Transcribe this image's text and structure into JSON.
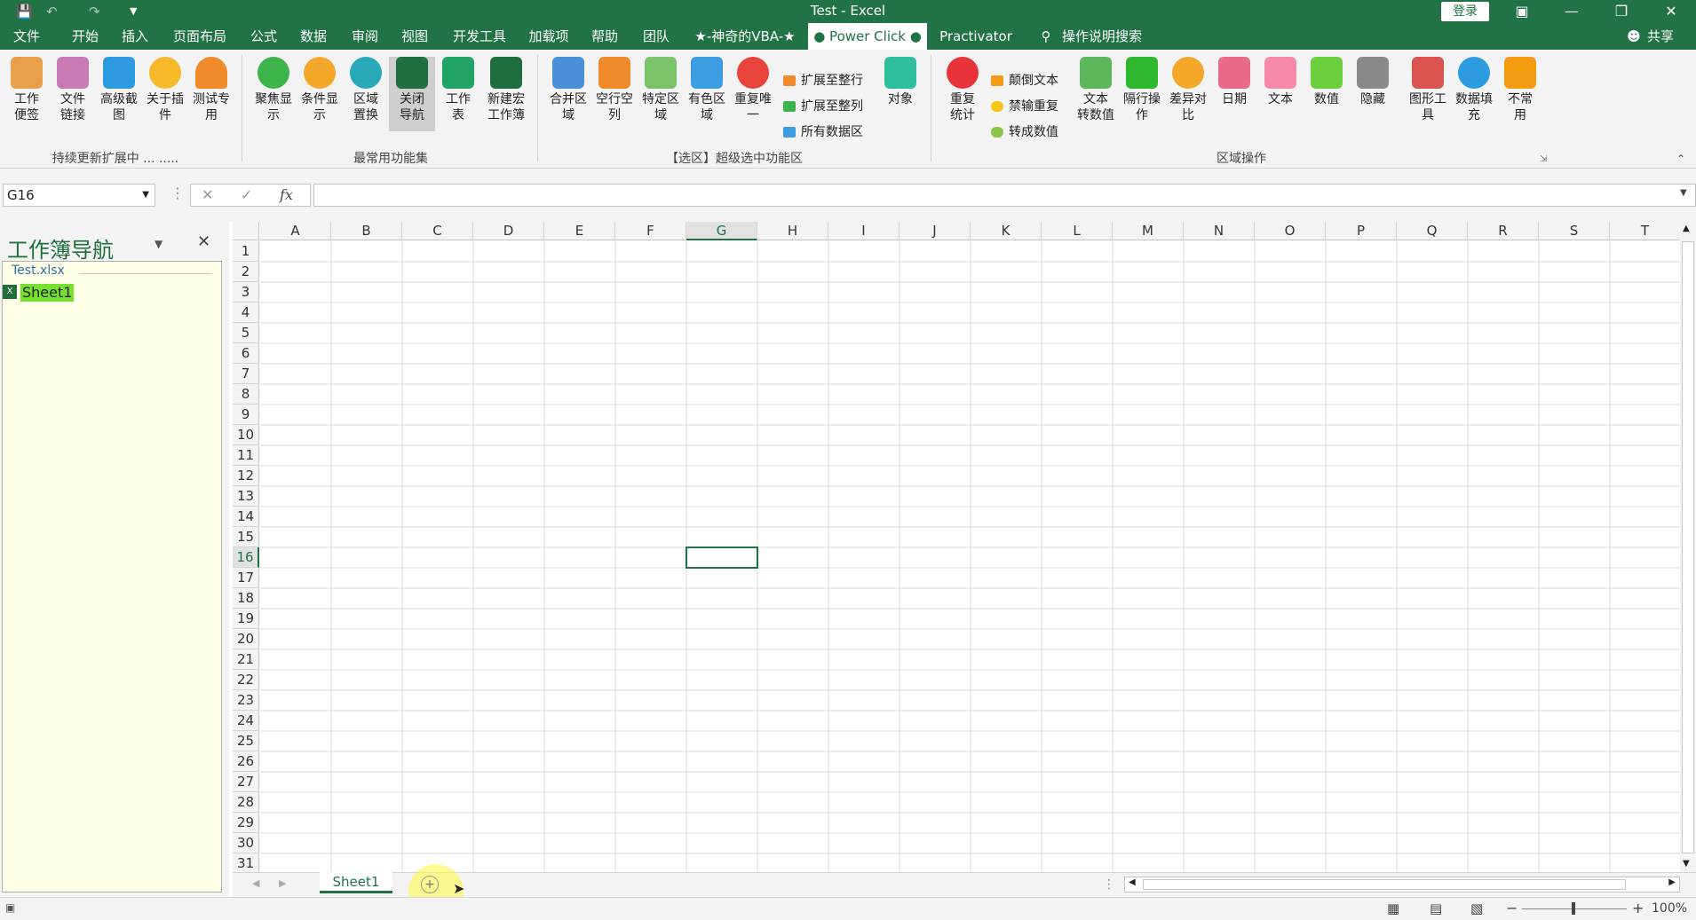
{
  "window": {
    "title": "Test  -  Excel",
    "login": "登录",
    "share": "共享"
  },
  "tabs": [
    "文件",
    "开始",
    "插入",
    "页面布局",
    "公式",
    "数据",
    "审阅",
    "视图",
    "开发工具",
    "加载项",
    "帮助",
    "团队",
    "★-神奇的VBA-★",
    "● Power Click ●",
    "Practivator"
  ],
  "tell_me": "操作说明搜索",
  "ribbon": {
    "group1": {
      "name": "持续更新扩展中 ... .....",
      "buttons": [
        "工作\n便签",
        "文件\n链接",
        "高级截\n图",
        "关于插\n件",
        "测试专\n用"
      ]
    },
    "group2": {
      "name": "最常用功能集",
      "buttons": [
        "聚焦显\n示",
        "条件显\n示",
        "区域\n置换",
        "关闭\n导航",
        "工作\n表",
        "新建宏\n工作簿"
      ]
    },
    "group3": {
      "name": "【选区】超级选中功能区",
      "buttons": [
        "合并区\n域",
        "空行空\n列",
        "特定区\n域",
        "有色区\n域",
        "重复唯\n一"
      ],
      "small": [
        "扩展至整行",
        "扩展至整列",
        "所有数据区"
      ],
      "big": "对象"
    },
    "group4": {
      "name": "区域操作",
      "first": "重复\n统计",
      "small": [
        "颠倒文本",
        "禁输重复",
        "转成数值"
      ],
      "buttons": [
        "文本\n转数值",
        "隔行操\n作",
        "差异对\n比",
        "日期",
        "文本",
        "数值",
        "隐藏",
        "图形工\n具",
        "数据填\n充",
        "不常\n用"
      ]
    }
  },
  "formula": {
    "namebox": "G16",
    "fx": "fx",
    "content": ""
  },
  "nav": {
    "title": "工作簿导航",
    "file": "Test.xlsx",
    "sheet": "Sheet1"
  },
  "grid": {
    "columns": [
      "A",
      "B",
      "C",
      "D",
      "E",
      "F",
      "G",
      "H",
      "I",
      "J",
      "K",
      "L",
      "M",
      "N",
      "O",
      "P",
      "Q",
      "R",
      "S",
      "T"
    ],
    "rows": [
      "1",
      "2",
      "3",
      "4",
      "5",
      "6",
      "7",
      "8",
      "9",
      "10",
      "11",
      "12",
      "13",
      "14",
      "15",
      "16",
      "17",
      "18",
      "19",
      "20",
      "21",
      "22",
      "23",
      "24",
      "25",
      "26",
      "27",
      "28",
      "29",
      "30",
      "31"
    ],
    "active_cell": "G16"
  },
  "sheets": [
    "Sheet1"
  ],
  "status": {
    "zoom": "100%"
  },
  "colors": {
    "accent": "#217346",
    "nav_bg": "#ffffe6",
    "sheet_highlight": "#76e02f"
  }
}
